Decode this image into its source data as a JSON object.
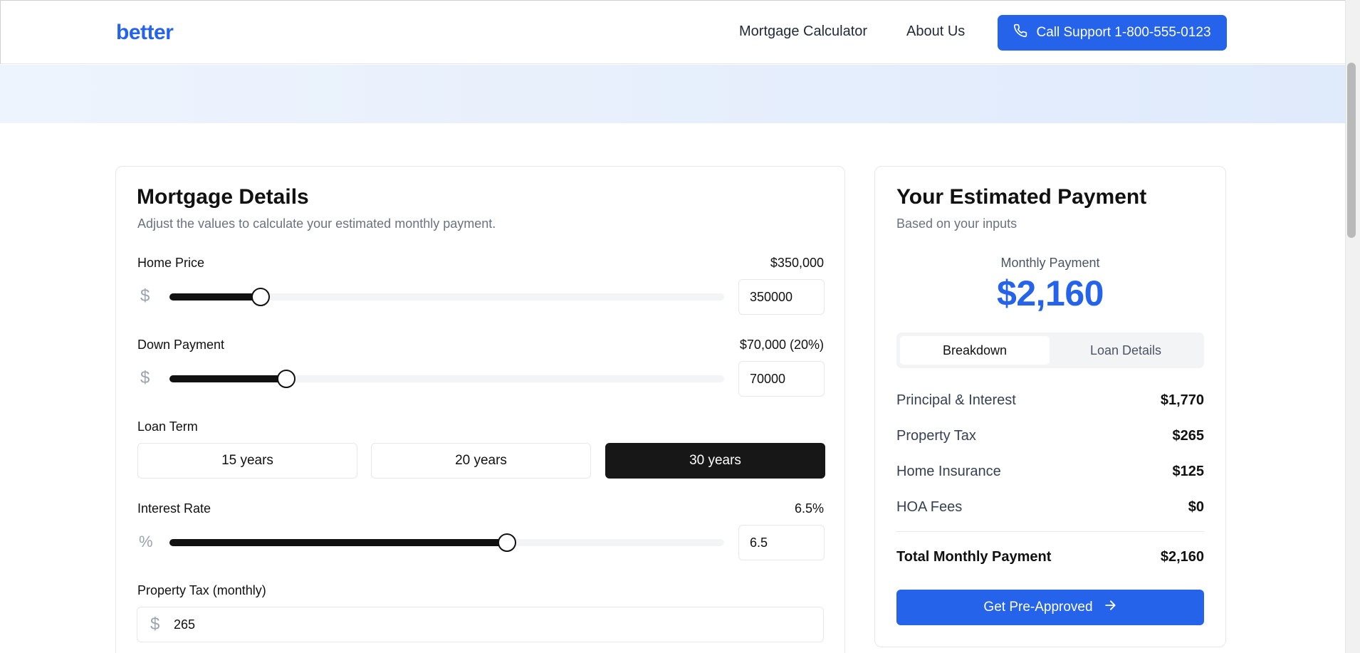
{
  "header": {
    "logo": "better",
    "nav": [
      "Mortgage Calculator",
      "About Us"
    ],
    "support_label": "Call Support 1-800-555-0123",
    "support_icon": "phone-icon"
  },
  "details": {
    "title": "Mortgage Details",
    "subtitle": "Adjust the values to calculate your estimated monthly payment.",
    "home_price": {
      "label": "Home Price",
      "display": "$350,000",
      "input": "350000",
      "slider_fraction": 0.164,
      "icon": "dollar-icon"
    },
    "down_payment": {
      "label": "Down Payment",
      "display": "$70,000 (20%)",
      "input": "70000",
      "slider_fraction": 0.211,
      "icon": "dollar-icon"
    },
    "loan_term": {
      "label": "Loan Term",
      "options": [
        "15 years",
        "20 years",
        "30 years"
      ],
      "selected": "30 years"
    },
    "interest_rate": {
      "label": "Interest Rate",
      "display": "6.5%",
      "input": "6.5",
      "slider_fraction": 0.608,
      "icon": "percent-icon"
    },
    "property_tax": {
      "label": "Property Tax (monthly)",
      "input": "265",
      "icon": "dollar-icon"
    }
  },
  "estimate": {
    "title": "Your Estimated Payment",
    "subtitle": "Based on your inputs",
    "monthly_label": "Monthly Payment",
    "monthly_value": "$2,160",
    "tabs": [
      "Breakdown",
      "Loan Details"
    ],
    "active_tab": "Breakdown",
    "breakdown": [
      {
        "label": "Principal & Interest",
        "value": "$1,770"
      },
      {
        "label": "Property Tax",
        "value": "$265"
      },
      {
        "label": "Home Insurance",
        "value": "$125"
      },
      {
        "label": "HOA Fees",
        "value": "$0"
      }
    ],
    "total_label": "Total Monthly Payment",
    "total_value": "$2,160",
    "cta_label": "Get Pre-Approved",
    "cta_icon": "arrow-right-icon"
  },
  "colors": {
    "accent": "#2563eb",
    "dark": "#171717",
    "muted": "#6b7280",
    "hero_band": "#e3ecfb"
  }
}
